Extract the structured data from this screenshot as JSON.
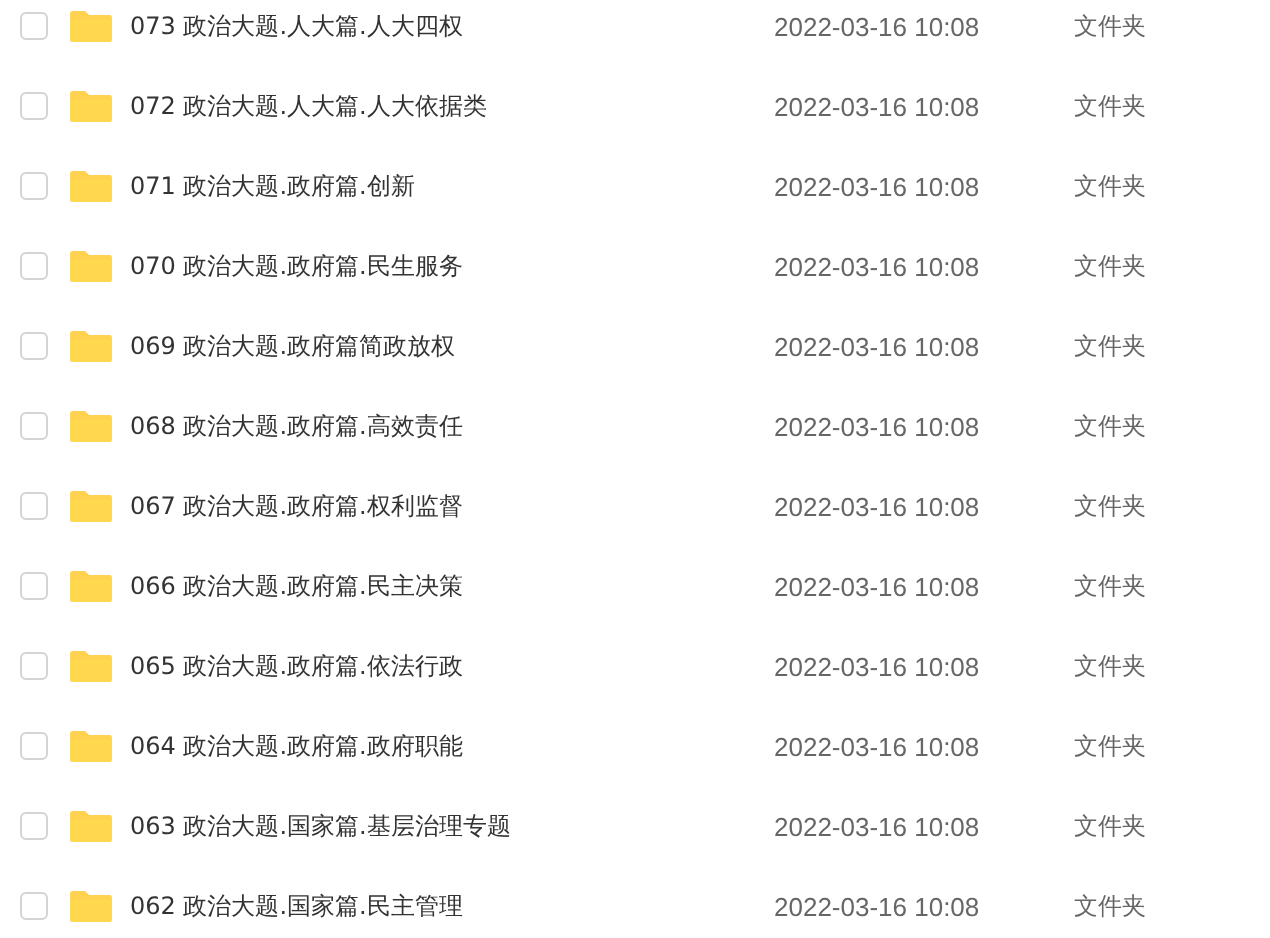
{
  "files": [
    {
      "name": "073 政治大题.人大篇.人大四权",
      "modified": "2022-03-16 10:08",
      "type": "文件夹",
      "checked": false
    },
    {
      "name": "072 政治大题.人大篇.人大依据类",
      "modified": "2022-03-16 10:08",
      "type": "文件夹",
      "checked": false
    },
    {
      "name": "071 政治大题.政府篇.创新",
      "modified": "2022-03-16 10:08",
      "type": "文件夹",
      "checked": false
    },
    {
      "name": "070 政治大题.政府篇.民生服务",
      "modified": "2022-03-16 10:08",
      "type": "文件夹",
      "checked": false
    },
    {
      "name": "069 政治大题.政府篇简政放权",
      "modified": "2022-03-16 10:08",
      "type": "文件夹",
      "checked": false
    },
    {
      "name": "068 政治大题.政府篇.高效责任",
      "modified": "2022-03-16 10:08",
      "type": "文件夹",
      "checked": false
    },
    {
      "name": "067 政治大题.政府篇.权利监督",
      "modified": "2022-03-16 10:08",
      "type": "文件夹",
      "checked": false
    },
    {
      "name": "066 政治大题.政府篇.民主决策",
      "modified": "2022-03-16 10:08",
      "type": "文件夹",
      "checked": false
    },
    {
      "name": "065 政治大题.政府篇.依法行政",
      "modified": "2022-03-16 10:08",
      "type": "文件夹",
      "checked": false
    },
    {
      "name": "064 政治大题.政府篇.政府职能",
      "modified": "2022-03-16 10:08",
      "type": "文件夹",
      "checked": false
    },
    {
      "name": "063 政治大题.国家篇.基层治理专题",
      "modified": "2022-03-16 10:08",
      "type": "文件夹",
      "checked": false
    },
    {
      "name": "062 政治大题.国家篇.民主管理",
      "modified": "2022-03-16 10:08",
      "type": "文件夹",
      "checked": false
    }
  ]
}
